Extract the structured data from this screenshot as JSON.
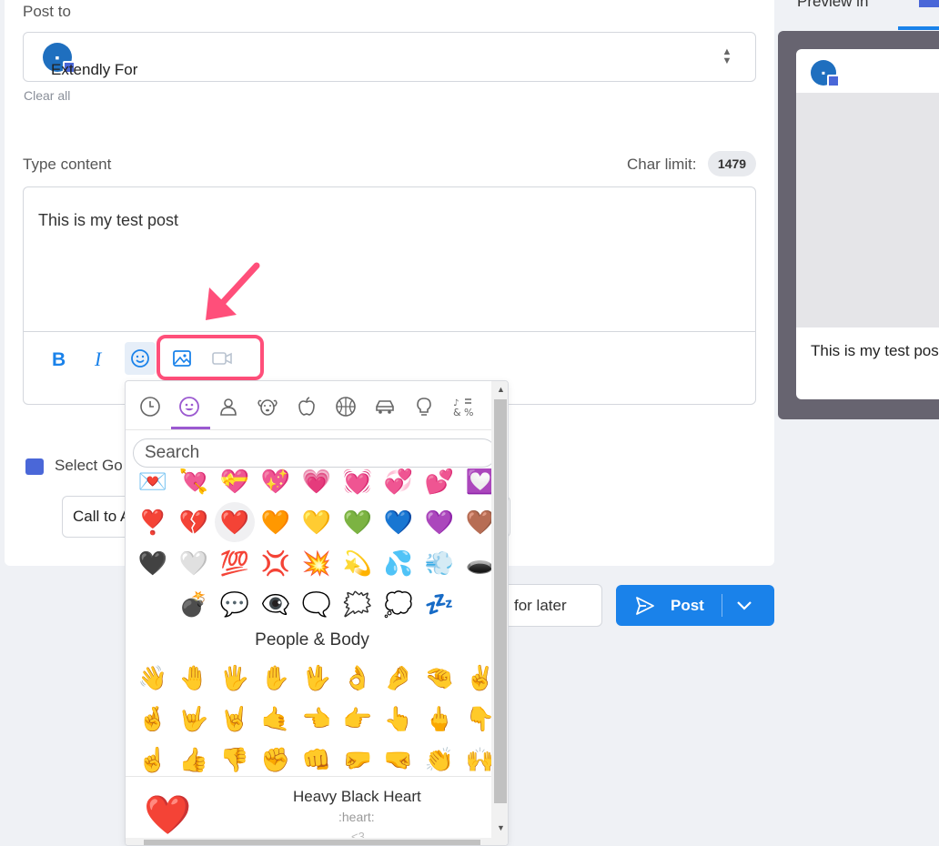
{
  "form": {
    "post_to_label": "Post to",
    "clear_all": "Clear all",
    "type_content_label": "Type content",
    "char_limit_label": "Char limit:",
    "char_limit_value": "1479",
    "content_text": "This is my test post",
    "select_gbp_label": "Select Go",
    "cta_value": "Call to A",
    "save_later_label": "for later",
    "post_button_label": "Post"
  },
  "preview": {
    "tab_label": "Preview in",
    "account_name": "Extendly For",
    "post_text": "This is my test pos"
  },
  "emoji_picker": {
    "search_placeholder": "Search",
    "categories": [
      "recent",
      "smileys",
      "people",
      "animals",
      "food",
      "activity",
      "travel",
      "objects",
      "symbols"
    ],
    "rows_top": [
      [
        "💌",
        "💘",
        "💝",
        "💖",
        "💗",
        "💓",
        "💞",
        "💕",
        "💟"
      ],
      [
        "❣️",
        "💔",
        "❤️",
        "🧡",
        "💛",
        "💚",
        "💙",
        "💜",
        "🤎"
      ],
      [
        "🖤",
        "🤍",
        "💯",
        "💢",
        "💥",
        "💫",
        "💦",
        "💨",
        "🕳️"
      ],
      [
        "",
        "💣",
        "💬",
        "👁️‍🗨️",
        "🗨️",
        "🗯️",
        "💭",
        "💤",
        ""
      ]
    ],
    "section_people": "People & Body",
    "rows_people": [
      [
        "👋",
        "🤚",
        "🖐️",
        "✋",
        "🖖",
        "👌",
        "🤌",
        "🤏",
        "✌️"
      ],
      [
        "🤞",
        "🤟",
        "🤘",
        "🤙",
        "👈",
        "👉",
        "👆",
        "🖕",
        "👇"
      ],
      [
        "☝️",
        "👍",
        "👎",
        "✊",
        "👊",
        "🤛",
        "🤜",
        "👏",
        "🙌"
      ]
    ],
    "selected_emoji": "❤️",
    "selected_name": "Heavy Black Heart",
    "selected_code": ":heart:",
    "selected_alt": "<3"
  },
  "colors": {
    "accent": "#1a82ea",
    "highlight": "#ff4f7a",
    "category_active": "#9b59d0"
  }
}
